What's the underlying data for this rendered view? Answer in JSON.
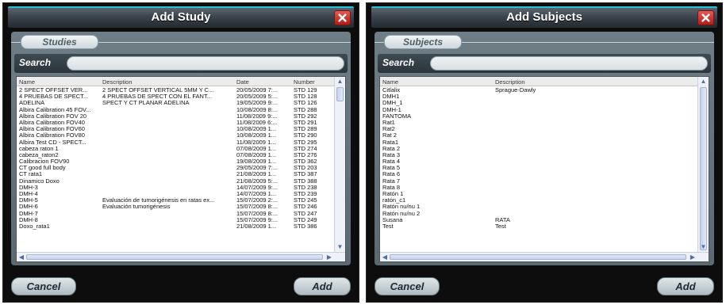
{
  "study_dialog": {
    "title": "Add Study",
    "section_label": "Studies",
    "search_label": "Search",
    "search_value": "",
    "columns": [
      "Name",
      "Description",
      "Date",
      "Number"
    ],
    "rows": [
      [
        "2 SPECT OFFSET VER...",
        "2 SPECT OFFSET VERTICAL 5MM Y C...",
        "20/05/2009 7:...",
        "STD 129"
      ],
      [
        "4 PRUEBAS DE SPECT...",
        "4 PRUEBAS DE SPECT CON EL FANT...",
        "20/05/2009 5:...",
        "STD 128"
      ],
      [
        "ADELINA",
        "SPECT Y CT PLANAR  ADELINA",
        "19/05/2009 9:...",
        "STD 126"
      ],
      [
        "Albira Calibration 45 FOV...",
        "",
        "10/08/2009 8:...",
        "STD 288"
      ],
      [
        "Albira Calibration FOV 20",
        "",
        "11/08/2009 9:...",
        "STD 292"
      ],
      [
        "Albira Calibration FOV40",
        "",
        "11/08/2009 6:...",
        "STD 291"
      ],
      [
        "Albira Calibration FOV60",
        "",
        "10/08/2009 1...",
        "STD 289"
      ],
      [
        "Albira Calibration FOV80",
        "",
        "10/08/2009 1...",
        "STD 290"
      ],
      [
        "Albira Test CD - SPECT...",
        "",
        "11/08/2009 1...",
        "STD 295"
      ],
      [
        "cabeza raton 1",
        "",
        "07/08/2009 1...",
        "STD 274"
      ],
      [
        "cabeza_raton2",
        "",
        "07/08/2009 1...",
        "STD 276"
      ],
      [
        "Calibracion FOV90",
        "",
        "19/08/2009 1...",
        "STD 362"
      ],
      [
        "CT good full body",
        "",
        "29/05/2009 7:...",
        "STD 203"
      ],
      [
        "CT rata1",
        "",
        "21/08/2009 1...",
        "STD 387"
      ],
      [
        "Dinamico Doxo",
        "",
        "21/08/2009 5:...",
        "STD 388"
      ],
      [
        "DMH-3",
        "",
        "14/07/2009 9:...",
        "STD 238"
      ],
      [
        "DMH-4",
        "",
        "14/07/2009 1...",
        "STD 239"
      ],
      [
        "DMH-5",
        "Evaluación de tumorigénesis en ratas ex...",
        "15/07/2009 2:...",
        "STD 245"
      ],
      [
        "DMH-6",
        "Evaluación tumorigénesis",
        "15/07/2009 8:...",
        "STD 246"
      ],
      [
        "DMH-7",
        "",
        "15/07/2009 8:...",
        "STD 247"
      ],
      [
        "DMH-8",
        "",
        "15/07/2009 9:...",
        "STD 249"
      ],
      [
        "Doxo_rata1",
        "",
        "21/08/2009 1...",
        "STD 386"
      ]
    ],
    "cancel_label": "Cancel",
    "add_label": "Add"
  },
  "subject_dialog": {
    "title": "Add Subjects",
    "section_label": "Subjects",
    "search_label": "Search",
    "search_value": "",
    "columns": [
      "Name",
      "Description"
    ],
    "rows": [
      [
        "Citlalix",
        "Sprague-Dawly"
      ],
      [
        "DMH1",
        ""
      ],
      [
        "DMH_1",
        ""
      ],
      [
        "DMH-1",
        ""
      ],
      [
        "FANTOMA",
        ""
      ],
      [
        "Rat1",
        ""
      ],
      [
        "Rat2",
        ""
      ],
      [
        "Rat 2",
        ""
      ],
      [
        "Rata1",
        ""
      ],
      [
        "Rata 2",
        ""
      ],
      [
        "Rata 3",
        ""
      ],
      [
        "Rata 4",
        ""
      ],
      [
        "Rata 5",
        ""
      ],
      [
        "Rata 6",
        ""
      ],
      [
        "Rata 7",
        ""
      ],
      [
        "Rata 8",
        ""
      ],
      [
        "Ratón 1",
        ""
      ],
      [
        "ratón_c1",
        ""
      ],
      [
        "Ratón nu/nu 1",
        ""
      ],
      [
        "Ratón nu/nu 2",
        ""
      ],
      [
        "Susana",
        "RATA"
      ],
      [
        "Test",
        "Test"
      ]
    ],
    "cancel_label": "Cancel",
    "add_label": "Add"
  },
  "icons": {
    "close": "close-icon",
    "scroll_up": "chevron-up-icon",
    "scroll_down": "chevron-down-icon",
    "scroll_left": "chevron-left-icon",
    "scroll_right": "chevron-right-icon"
  },
  "colors": {
    "accent": "#26c3d8",
    "close_button": "#c8231c",
    "panel": "#66757c"
  }
}
